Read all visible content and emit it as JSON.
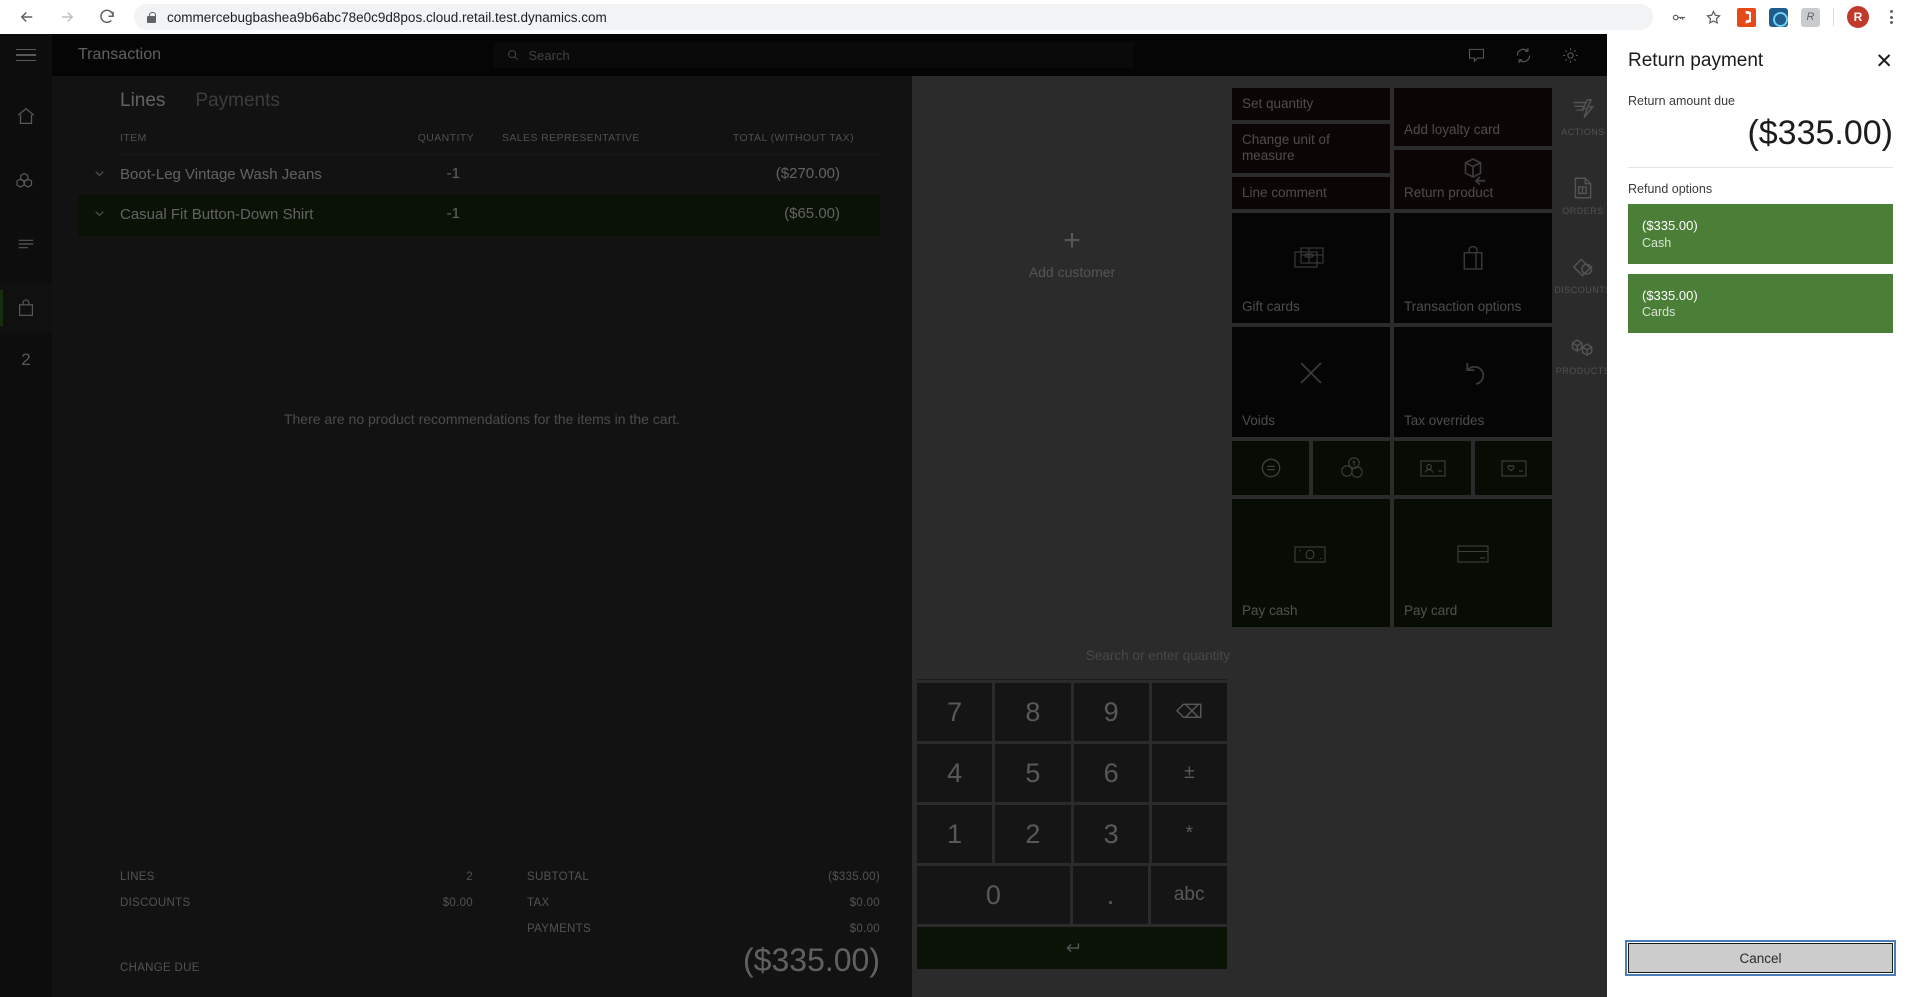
{
  "browser": {
    "back_icon": "arrow-left-icon",
    "forward_icon": "arrow-right-icon",
    "reload_icon": "reload-icon",
    "lock_icon": "lock-icon",
    "url": "commercebugbashea9b6abc78e0c9d8pos.cloud.retail.test.dynamics.com",
    "key_icon": "key-icon",
    "star_icon": "star-icon",
    "ext_office": "office-extension-icon",
    "ext_blue": "blue-extension-icon",
    "ext_gray": "gray-extension-icon",
    "profile_initial": "R",
    "menu_icon": "kebab-menu-icon"
  },
  "topbar": {
    "menu_icon": "hamburger-icon",
    "title": "Transaction",
    "search_placeholder": "Search",
    "search_icon": "search-icon",
    "comment_icon": "comment-icon",
    "sync_icon": "sync-icon",
    "settings_icon": "gear-icon"
  },
  "left_rail": {
    "items": [
      {
        "icon": "home-icon",
        "name": "home"
      },
      {
        "icon": "products-icon",
        "name": "products"
      },
      {
        "icon": "lines-icon",
        "name": "lines"
      },
      {
        "icon": "cart-bag-icon",
        "name": "cart",
        "active": true
      }
    ],
    "badge": "2"
  },
  "cart": {
    "tabs": [
      {
        "label": "Lines",
        "active": true
      },
      {
        "label": "Payments",
        "active": false
      }
    ],
    "columns": {
      "item": "ITEM",
      "quantity": "QUANTITY",
      "sales_rep": "SALES REPRESENTATIVE",
      "total": "TOTAL (WITHOUT TAX)"
    },
    "rows": [
      {
        "chevron": "chevron-down-icon",
        "item": "Boot-Leg Vintage Wash Jeans",
        "quantity": "-1",
        "sales_rep": "",
        "total": "($270.00)",
        "selected": false
      },
      {
        "chevron": "chevron-down-icon",
        "item": "Casual Fit Button-Down Shirt",
        "quantity": "-1",
        "sales_rep": "",
        "total": "($65.00)",
        "selected": true
      }
    ],
    "recommendation_message": "There are no product recommendations for the items in the cart.",
    "totals_left": [
      {
        "label": "LINES",
        "value": "2"
      },
      {
        "label": "DISCOUNTS",
        "value": "$0.00"
      }
    ],
    "totals_right": [
      {
        "label": "SUBTOTAL",
        "value": "($335.00)"
      },
      {
        "label": "TAX",
        "value": "$0.00"
      },
      {
        "label": "PAYMENTS",
        "value": "$0.00"
      }
    ],
    "change_due_label": "CHANGE DUE",
    "change_due_value": "($335.00)"
  },
  "customer": {
    "plus_icon": "plus-icon",
    "add_label": "Add customer"
  },
  "keypad": {
    "qty_placeholder": "Search or enter quantity",
    "keys": [
      [
        "7",
        "8",
        "9",
        "backspace-icon"
      ],
      [
        "4",
        "5",
        "6",
        "±"
      ],
      [
        "1",
        "2",
        "3",
        "*"
      ],
      [
        "0",
        ".",
        "abc"
      ]
    ],
    "enter_icon": "enter-icon",
    "backspace_label": "⌫",
    "abc_label": "abc"
  },
  "tiles": {
    "set_quantity": "Set quantity",
    "add_loyalty_card": "Add loyalty card",
    "change_unit_of_measure": "Change unit of measure",
    "line_comment": "Line comment",
    "return_product": "Return product",
    "return_product_icon": "return-box-icon",
    "gift_cards": "Gift cards",
    "gift_cards_icon": "gift-card-icon",
    "transaction_options": "Transaction options",
    "transaction_options_icon": "shopping-bag-icon",
    "voids": "Voids",
    "voids_icon": "close-x-icon",
    "tax_overrides": "Tax overrides",
    "tax_overrides_icon": "undo-arrow-icon",
    "quick_buttons": [
      {
        "icon": "equals-circle-icon",
        "name": "price-check"
      },
      {
        "icon": "currency-coins-icon",
        "name": "currency"
      },
      {
        "icon": "id-card-icon",
        "name": "customer-card"
      },
      {
        "icon": "loyalty-card-icon",
        "name": "loyalty-card"
      }
    ],
    "pay_cash": "Pay cash",
    "pay_cash_icon": "banknote-icon",
    "pay_card": "Pay card",
    "pay_card_icon": "credit-card-icon"
  },
  "nav_rail": [
    {
      "label": "ACTIONS",
      "icon": "lightning-lines-icon",
      "active": true
    },
    {
      "label": "ORDERS",
      "icon": "document-icon",
      "active": false
    },
    {
      "label": "DISCOUNTS",
      "icon": "discount-tag-icon",
      "active": false
    },
    {
      "label": "PRODUCTS",
      "icon": "boxes-icon",
      "active": false
    }
  ],
  "flyout": {
    "title": "Return payment",
    "close_icon": "close-icon",
    "amount_label": "Return amount due",
    "amount_value": "($335.00)",
    "refund_options_label": "Refund options",
    "options": [
      {
        "amount": "($335.00)",
        "name": "Cash"
      },
      {
        "amount": "($335.00)",
        "name": "Cards"
      }
    ],
    "cancel_label": "Cancel"
  },
  "colors": {
    "accent_green": "#4b7f38",
    "selected_row": "#162a0d",
    "focus_blue": "#4a7ebb"
  }
}
